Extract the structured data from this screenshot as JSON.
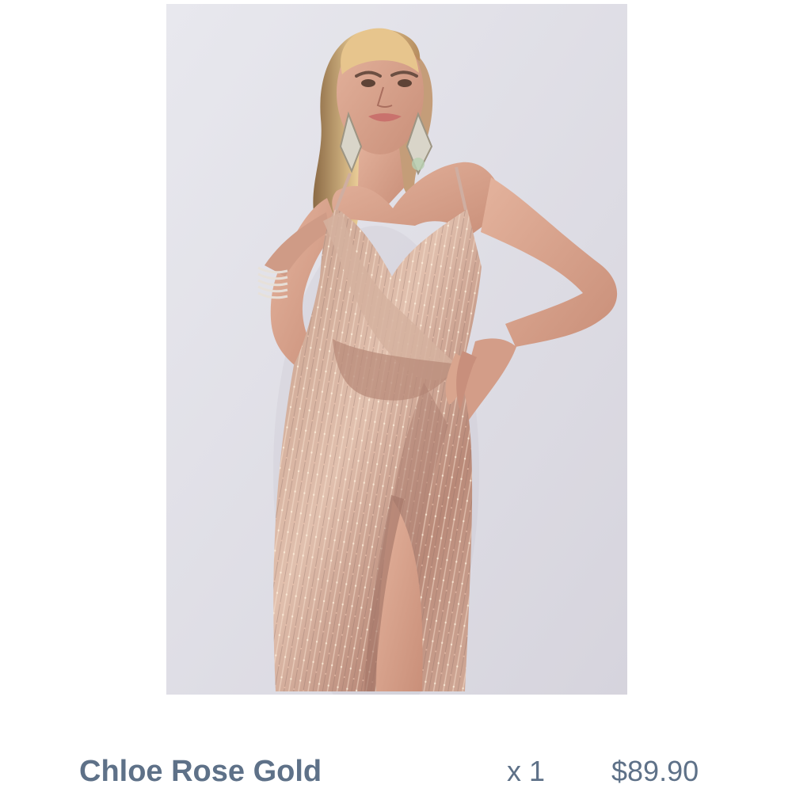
{
  "product": {
    "name": "Chloe Rose Gold",
    "quantity_label": "x 1",
    "price": "$89.90",
    "image_icon": "product-photo"
  },
  "colors": {
    "text": "#5e7188",
    "background": "#ffffff",
    "photo_backdrop": "#dcdbe2",
    "dress": "#c99f88",
    "skin": "#d9a58e",
    "hair": "#d8b27a"
  }
}
